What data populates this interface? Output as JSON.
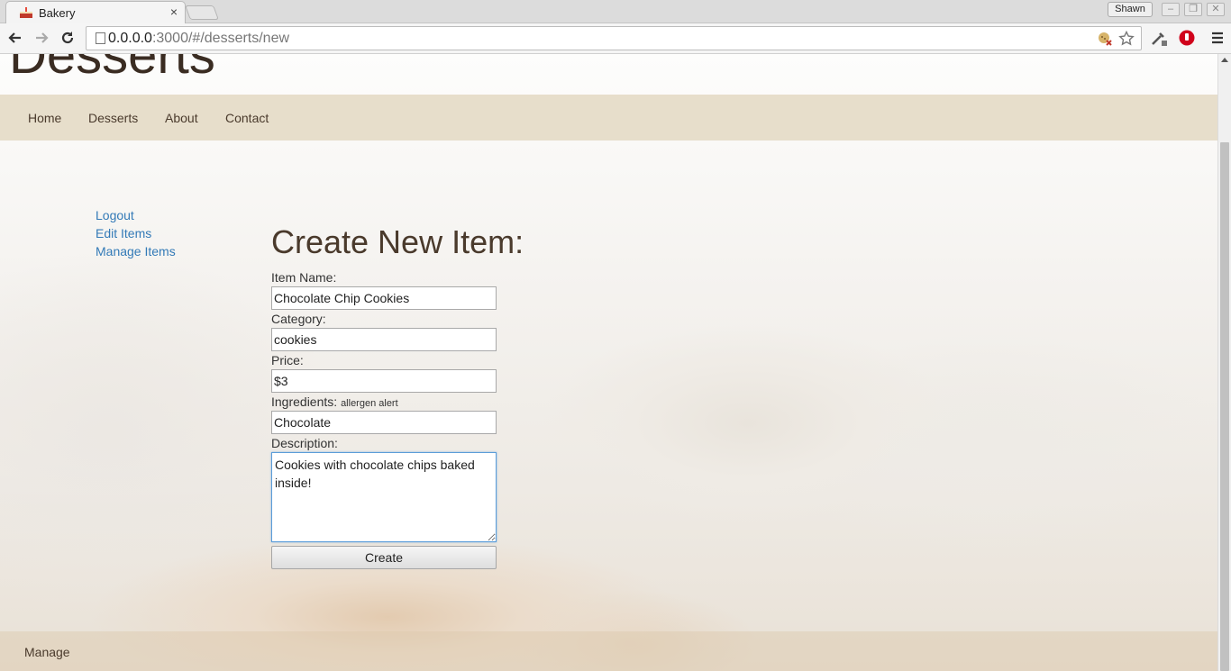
{
  "browser": {
    "tab_title": "Bakery",
    "tab_close": "×",
    "profile_name": "Shawn",
    "url_host": "0.0.0.0",
    "url_path": ":3000/#/desserts/new"
  },
  "site": {
    "title": "Desserts",
    "nav": [
      "Home",
      "Desserts",
      "About",
      "Contact"
    ],
    "sidebar": [
      "Logout",
      "Edit Items",
      "Manage Items"
    ],
    "footer_link": "Manage"
  },
  "form": {
    "heading": "Create New Item:",
    "item_name_label": "Item Name:",
    "item_name_value": "Chocolate Chip Cookies",
    "category_label": "Category:",
    "category_value": "cookies",
    "price_label": "Price:",
    "price_value": "$3",
    "ingredients_label": "Ingredients:",
    "ingredients_note": "allergen alert",
    "ingredients_value": "Chocolate",
    "description_label": "Description:",
    "description_value": "Cookies with chocolate chips baked inside!",
    "submit_label": "Create"
  },
  "colors": {
    "navbar_bg": "#e7decb",
    "link": "#337ab7",
    "heading": "#4a3a2c"
  }
}
